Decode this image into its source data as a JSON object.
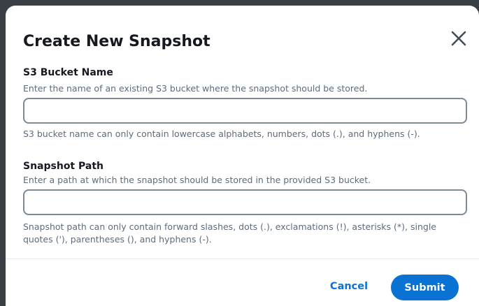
{
  "modal": {
    "title": "Create New Snapshot",
    "close_icon": "close-icon"
  },
  "bucket_field": {
    "label": "S3 Bucket Name",
    "description": "Enter the name of an existing S3 bucket where the snapshot should be stored.",
    "value": "",
    "placeholder": "",
    "help": "S3 bucket name can only contain lowercase alphabets, numbers, dots (.), and hyphens (-)."
  },
  "path_field": {
    "label": "Snapshot Path",
    "description": "Enter a path at which the snapshot should be stored in the provided S3 bucket.",
    "value": "",
    "placeholder": "",
    "help": "Snapshot path can only contain forward slashes, dots (.), exclamations (!), asterisks (*), single quotes ('), parentheses (), and hyphens (-)."
  },
  "footer": {
    "cancel_label": "Cancel",
    "submit_label": "Submit"
  },
  "colors": {
    "primary": "#0972d3",
    "text": "#16191f",
    "secondary_text": "#5f6b7a",
    "input_border": "#7d8998"
  }
}
